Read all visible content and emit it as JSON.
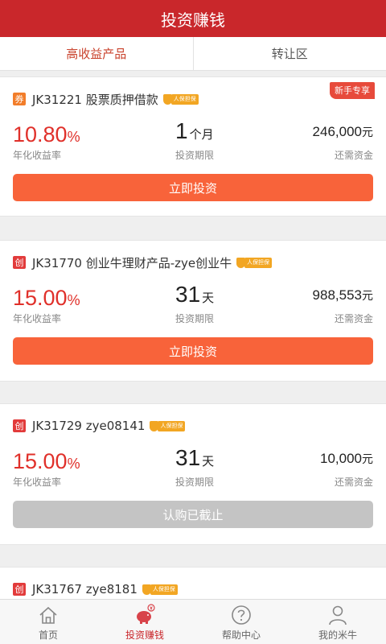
{
  "header": {
    "title": "投资赚钱"
  },
  "tabs": [
    {
      "label": "高收益产品",
      "active": true
    },
    {
      "label": "转让区",
      "active": false
    }
  ],
  "insurance_text": "人保担保",
  "products": [
    {
      "tag": "券",
      "tag_type": "coupon",
      "name": "JK31221 股票质押借款",
      "new_badge": "新手专享",
      "rate": "10.80",
      "rate_unit": "%",
      "rate_label": "年化收益率",
      "term": "1",
      "term_unit": "个月",
      "term_label": "投资期限",
      "remaining": "246,000",
      "remaining_unit": "元",
      "remaining_label": "还需资金",
      "button": "立即投资",
      "button_state": "invest"
    },
    {
      "tag": "创",
      "tag_type": "startup",
      "name": "JK31770 创业牛理财产品-zye创业牛",
      "rate": "15.00",
      "rate_unit": "%",
      "rate_label": "年化收益率",
      "term": "31",
      "term_unit": "天",
      "term_label": "投资期限",
      "remaining": "988,553",
      "remaining_unit": "元",
      "remaining_label": "还需资金",
      "button": "立即投资",
      "button_state": "invest"
    },
    {
      "tag": "创",
      "tag_type": "startup",
      "name": "JK31729 zye08141",
      "rate": "15.00",
      "rate_unit": "%",
      "rate_label": "年化收益率",
      "term": "31",
      "term_unit": "天",
      "term_label": "投资期限",
      "remaining": "10,000",
      "remaining_unit": "元",
      "remaining_label": "还需资金",
      "button": "认购已截止",
      "button_state": "closed"
    },
    {
      "tag": "创",
      "tag_type": "startup",
      "name": "JK31767 zye8181"
    }
  ],
  "bottom_nav": [
    {
      "label": "首页",
      "icon": "home-icon",
      "active": false
    },
    {
      "label": "投资赚钱",
      "icon": "piggy-bank-icon",
      "active": true
    },
    {
      "label": "帮助中心",
      "icon": "help-icon",
      "active": false
    },
    {
      "label": "我的米牛",
      "icon": "user-icon",
      "active": false
    }
  ],
  "colors": {
    "brand_red": "#c9272b",
    "rate_red": "#e0302a",
    "invest_button": "#f8633a",
    "closed_button": "#c4c4c4",
    "insurance_gold": "#f2a623"
  }
}
